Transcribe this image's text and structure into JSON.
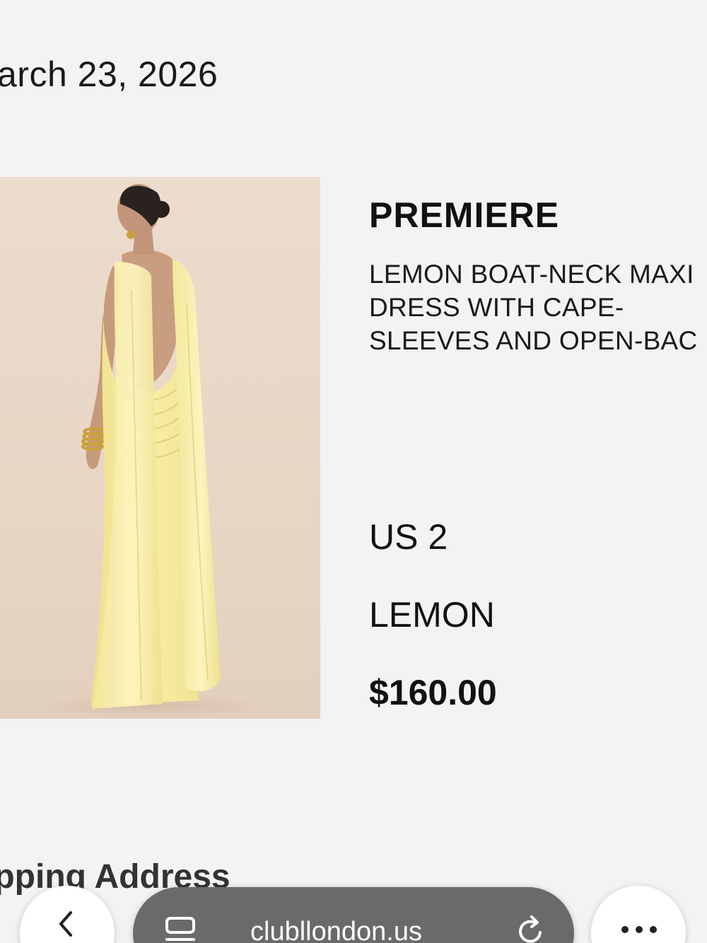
{
  "order": {
    "date": "arch 23, 2026"
  },
  "product": {
    "brand": "PREMIERE",
    "name_lines": [
      "LEMON BOAT-NECK MAXI",
      "DRESS WITH CAPE-",
      "SLEEVES AND OPEN-BAC"
    ],
    "size": "US 2",
    "color": "LEMON",
    "price": "$160.00",
    "image": "lemon-maxi-dress-photo"
  },
  "sections": {
    "shipping_heading": "ipping Address"
  },
  "browser": {
    "url": "clubllondon.us",
    "back_icon": "chevron-left-icon",
    "tabs_icon": "tabs-icon",
    "reload_icon": "reload-icon",
    "more_icon": "more-dots-icon"
  },
  "colors": {
    "background": "#f3f3f3",
    "dress": "#f6ec9e",
    "url_bar": "#6a6a6a"
  }
}
